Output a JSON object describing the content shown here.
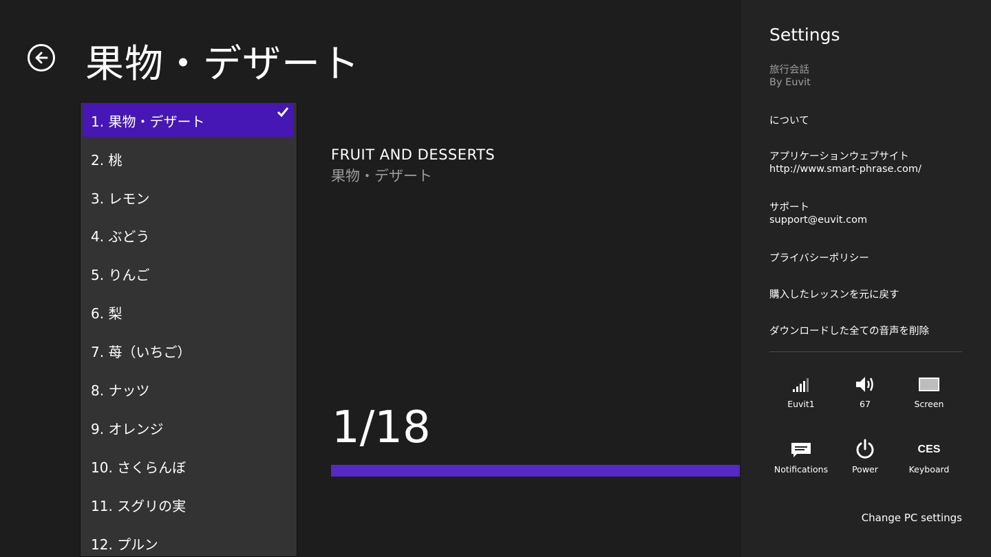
{
  "app": {
    "page_title": "果物・デザート"
  },
  "lesson_list": {
    "items": [
      {
        "label": "1. 果物・デザート",
        "selected": true
      },
      {
        "label": "2. 桃",
        "selected": false
      },
      {
        "label": "3. レモン",
        "selected": false
      },
      {
        "label": "4. ぶどう",
        "selected": false
      },
      {
        "label": "5. りんご",
        "selected": false
      },
      {
        "label": "6. 梨",
        "selected": false
      },
      {
        "label": "7. 苺（いちご）",
        "selected": false
      },
      {
        "label": "8. ナッツ",
        "selected": false
      },
      {
        "label": "9. オレンジ",
        "selected": false
      },
      {
        "label": "10. さくらんぼ",
        "selected": false
      },
      {
        "label": "11. スグリの実",
        "selected": false
      },
      {
        "label": "12. プルン",
        "selected": false
      }
    ],
    "selected_icon": "checkmark-icon"
  },
  "content": {
    "heading_en": "FRUIT AND DESSERTS",
    "heading_jp": "果物・デザート",
    "counter": "1/18",
    "progress_fraction": 1.0,
    "accent_color": "#5528c8"
  },
  "settings": {
    "title": "Settings",
    "app_name": "旅行会話",
    "publisher": "By Euvit",
    "about": "について",
    "website_label": "アプリケーションウェブサイト",
    "website_url": "http://www.smart-phrase.com/",
    "support_label": "サポート",
    "support_email": "support@euvit.com",
    "privacy": "プライバシーポリシー",
    "restore": "購入したレッスンを元に戻す",
    "delete_audio": "ダウンロードした全ての音声を削除",
    "tiles": [
      {
        "icon": "network-signal-icon",
        "label": "Euvit1"
      },
      {
        "icon": "volume-icon",
        "label": "67"
      },
      {
        "icon": "screen-icon",
        "label": "Screen"
      },
      {
        "icon": "notifications-icon",
        "label": "Notifications"
      },
      {
        "icon": "power-icon",
        "label": "Power"
      },
      {
        "icon": "keyboard-icon",
        "label": "Keyboard",
        "glyph": "CES"
      }
    ],
    "change_pc": "Change PC settings"
  },
  "colors": {
    "background": "#1d1d1d",
    "settings_pane": "#232323",
    "list_panel": "#333333",
    "selected_item": "#4617b4"
  }
}
